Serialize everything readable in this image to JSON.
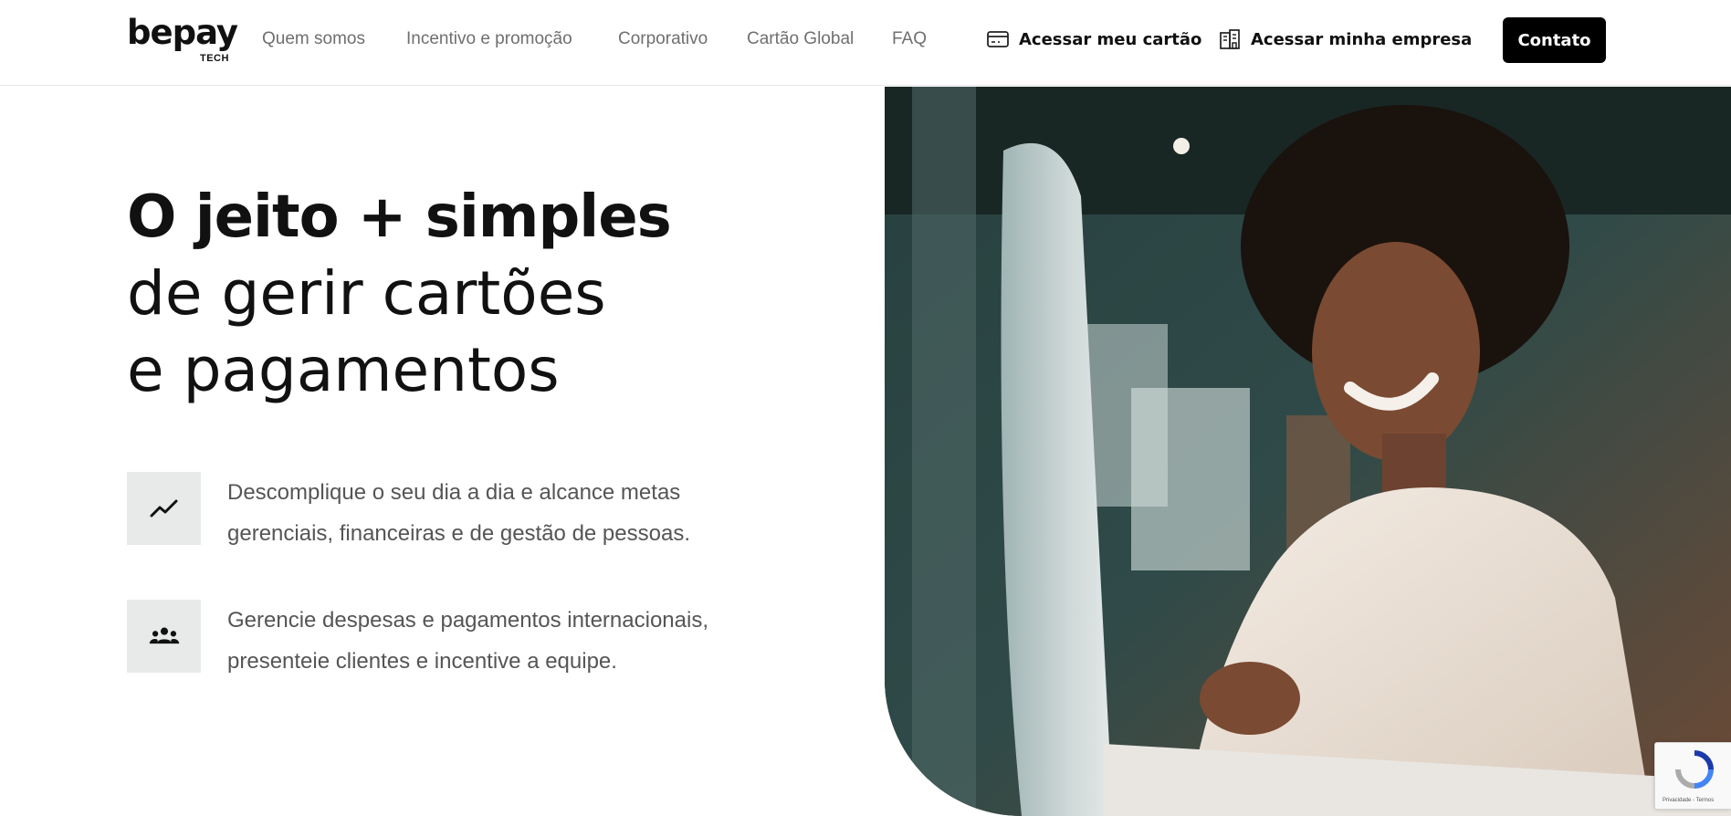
{
  "brand": {
    "name": "bepay",
    "sub": "TECH"
  },
  "nav": {
    "links": [
      "Quem somos",
      "Incentivo e promoção",
      "Corporativo",
      "Cartão Global",
      "FAQ"
    ],
    "access_card": "Acessar meu cartão",
    "access_company": "Acessar minha empresa",
    "contact": "Contato"
  },
  "hero": {
    "line1": "O jeito + simples",
    "line2": "de gerir cartões",
    "line3": "e pagamentos"
  },
  "features": [
    {
      "icon": "trending-up-icon",
      "text": "Descomplique o seu dia a dia e alcance metas gerenciais, financeiras e de gestão de pessoas."
    },
    {
      "icon": "group-icon",
      "text": "Gerencie despesas e pagamentos internacionais, presenteie clientes e incentive a equipe."
    }
  ],
  "recaptcha": {
    "links": "Privacidade - Termos"
  },
  "colors": {
    "accent": "#000000",
    "text_muted": "#6f6f6f",
    "icon_bg": "#e8eaea"
  }
}
